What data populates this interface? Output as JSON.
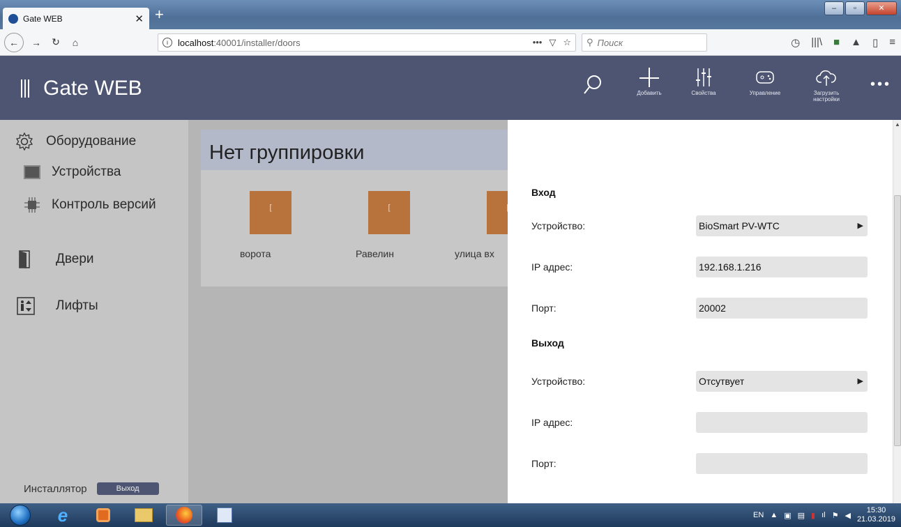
{
  "browser": {
    "tab_title": "Gate WEB",
    "url_host": "localhost",
    "url_path": ":40001/installer/doors",
    "url_more": "•••",
    "search_placeholder": "Поиск"
  },
  "app": {
    "title": "Gate WEB",
    "header_buttons": [
      {
        "label": "Добавить",
        "icon": "plus-icon"
      },
      {
        "label": "Свойства",
        "icon": "sliders-icon"
      },
      {
        "label": "Управление",
        "icon": "gamepad-icon"
      },
      {
        "label": "Загрузить настройки",
        "icon": "cloud-upload-icon"
      }
    ],
    "more": "•••"
  },
  "sidebar": {
    "items": [
      {
        "label": "Оборудование",
        "icon": "gear-icon"
      },
      {
        "label": "Устройства",
        "icon": "device-icon"
      },
      {
        "label": "Контроль версий",
        "icon": "chip-icon"
      },
      {
        "label": "Двери",
        "icon": "door-icon"
      },
      {
        "label": "Лифты",
        "icon": "elevator-icon"
      }
    ],
    "role": "Инсталлятор",
    "logout": "Выход"
  },
  "main": {
    "group_title": "Нет группировки",
    "doors": [
      {
        "label": "ворота",
        "glyph": "["
      },
      {
        "label": "Равелин",
        "glyph": "["
      },
      {
        "label": "улица вх",
        "glyph": "["
      }
    ]
  },
  "panel": {
    "entry": {
      "title": "Вход",
      "device_label": "Устройство:",
      "device_value": "BioSmart PV-WTC",
      "ip_label": "IP адрес:",
      "ip_value": "192.168.1.216",
      "port_label": "Порт:",
      "port_value": "20002"
    },
    "exit": {
      "title": "Выход",
      "device_label": "Устройство:",
      "device_value": "Отсутвует",
      "ip_label": "IP адрес:",
      "ip_value": "",
      "port_label": "Порт:",
      "port_value": ""
    }
  },
  "taskbar": {
    "lang": "EN",
    "time": "15:30",
    "date": "21.03.2019"
  },
  "colors": {
    "header": "#4d5572",
    "sidebar": "#c5c5c5",
    "door": "#b8733c"
  }
}
